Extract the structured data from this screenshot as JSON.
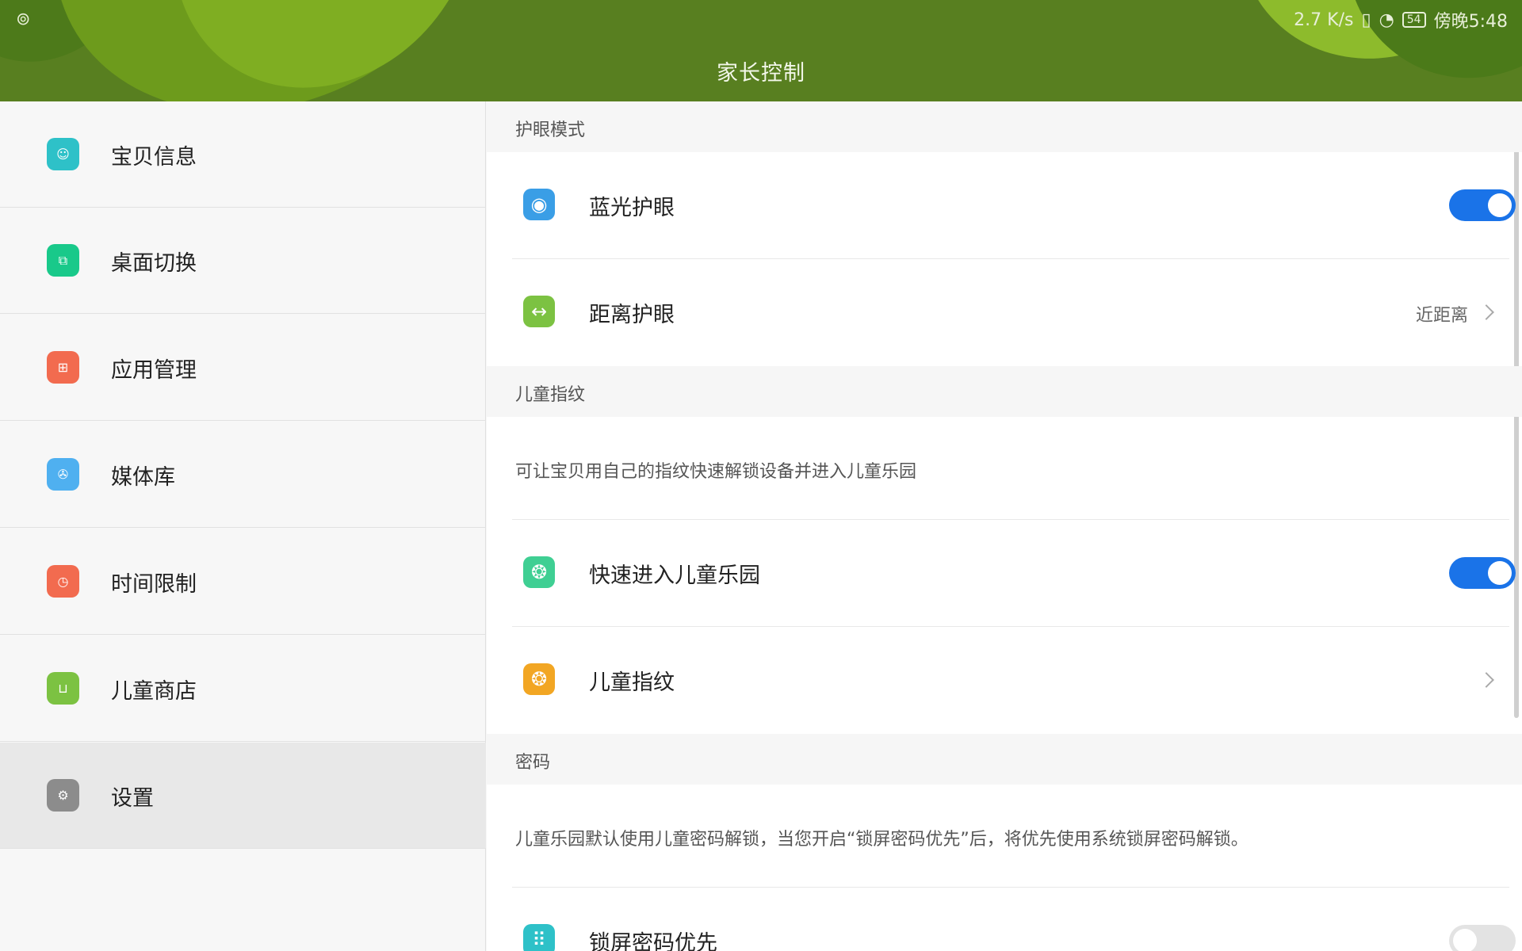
{
  "status_bar": {
    "left_icon": "netease-cloud-music-icon",
    "net_speed": "2.7 K/s",
    "icons": [
      "vibrate-icon",
      "wifi-icon"
    ],
    "battery": "54",
    "time": "傍晚5:48"
  },
  "header": {
    "title": "家长控制"
  },
  "sidebar": {
    "items": [
      {
        "label": "宝贝信息",
        "icon": "baby-face-icon",
        "color": "#2ec1c8",
        "glyph": "☺"
      },
      {
        "label": "桌面切换",
        "icon": "desktop-switch-icon",
        "color": "#19c98a",
        "glyph": "⧉"
      },
      {
        "label": "应用管理",
        "icon": "app-grid-icon",
        "color": "#f26b4f",
        "glyph": "⊞"
      },
      {
        "label": "媒体库",
        "icon": "film-reel-icon",
        "color": "#4fb0f0",
        "glyph": "✇"
      },
      {
        "label": "时间限制",
        "icon": "clock-icon",
        "color": "#f26b4f",
        "glyph": "◷"
      },
      {
        "label": "儿童商店",
        "icon": "shopping-bag-icon",
        "color": "#7cc242",
        "glyph": "⊔"
      },
      {
        "label": "设置",
        "icon": "gear-icon",
        "color": "#8c8c8c",
        "glyph": "⚙"
      }
    ],
    "active_index": 6
  },
  "sections": {
    "eye": {
      "title": "护眼模式",
      "blue_light": {
        "label": "蓝光护眼",
        "icon": "eye-icon",
        "color": "#3a9ee6",
        "glyph": "◉",
        "enabled": true
      },
      "distance": {
        "label": "距离护眼",
        "icon": "distance-arrows-icon",
        "color": "#7cc242",
        "glyph": "↔",
        "value": "近距离"
      }
    },
    "fingerprint": {
      "title": "儿童指纹",
      "description": "可让宝贝用自己的指纹快速解锁设备并进入儿童乐园",
      "quick_enter": {
        "label": "快速进入儿童乐园",
        "icon": "fingerprint-icon",
        "color": "#3fcf93",
        "glyph": "❂",
        "enabled": true
      },
      "child_fp": {
        "label": "儿童指纹",
        "icon": "fingerprint-add-icon",
        "color": "#f2a623",
        "glyph": "❂"
      }
    },
    "password": {
      "title": "密码",
      "description": "儿童乐园默认使用儿童密码解锁，当您开启“锁屏密码优先”后，将优先使用系统锁屏密码解锁。",
      "lock_priority": {
        "label": "锁屏密码优先",
        "icon": "keypad-icon",
        "color": "#2ec1c8",
        "glyph": "⠿",
        "enabled": false
      }
    }
  }
}
